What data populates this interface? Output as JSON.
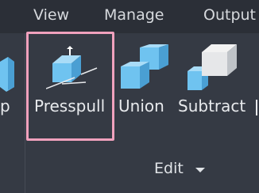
{
  "menubar": {
    "items": [
      {
        "label": "View"
      },
      {
        "label": "Manage"
      },
      {
        "label": "Output"
      }
    ]
  },
  "ribbon": {
    "left_partial_label": "p",
    "tools": [
      {
        "label": "Presspull",
        "icon": "presspull-icon"
      },
      {
        "label": "Union",
        "icon": "union-icon"
      },
      {
        "label": "Subtract",
        "icon": "subtract-icon"
      }
    ],
    "panel_label": "Edit",
    "panel_dropdown_icon": "caret-down-icon",
    "highlight_color": "#f0a1bd",
    "accent_color": "#6fc3f0"
  }
}
